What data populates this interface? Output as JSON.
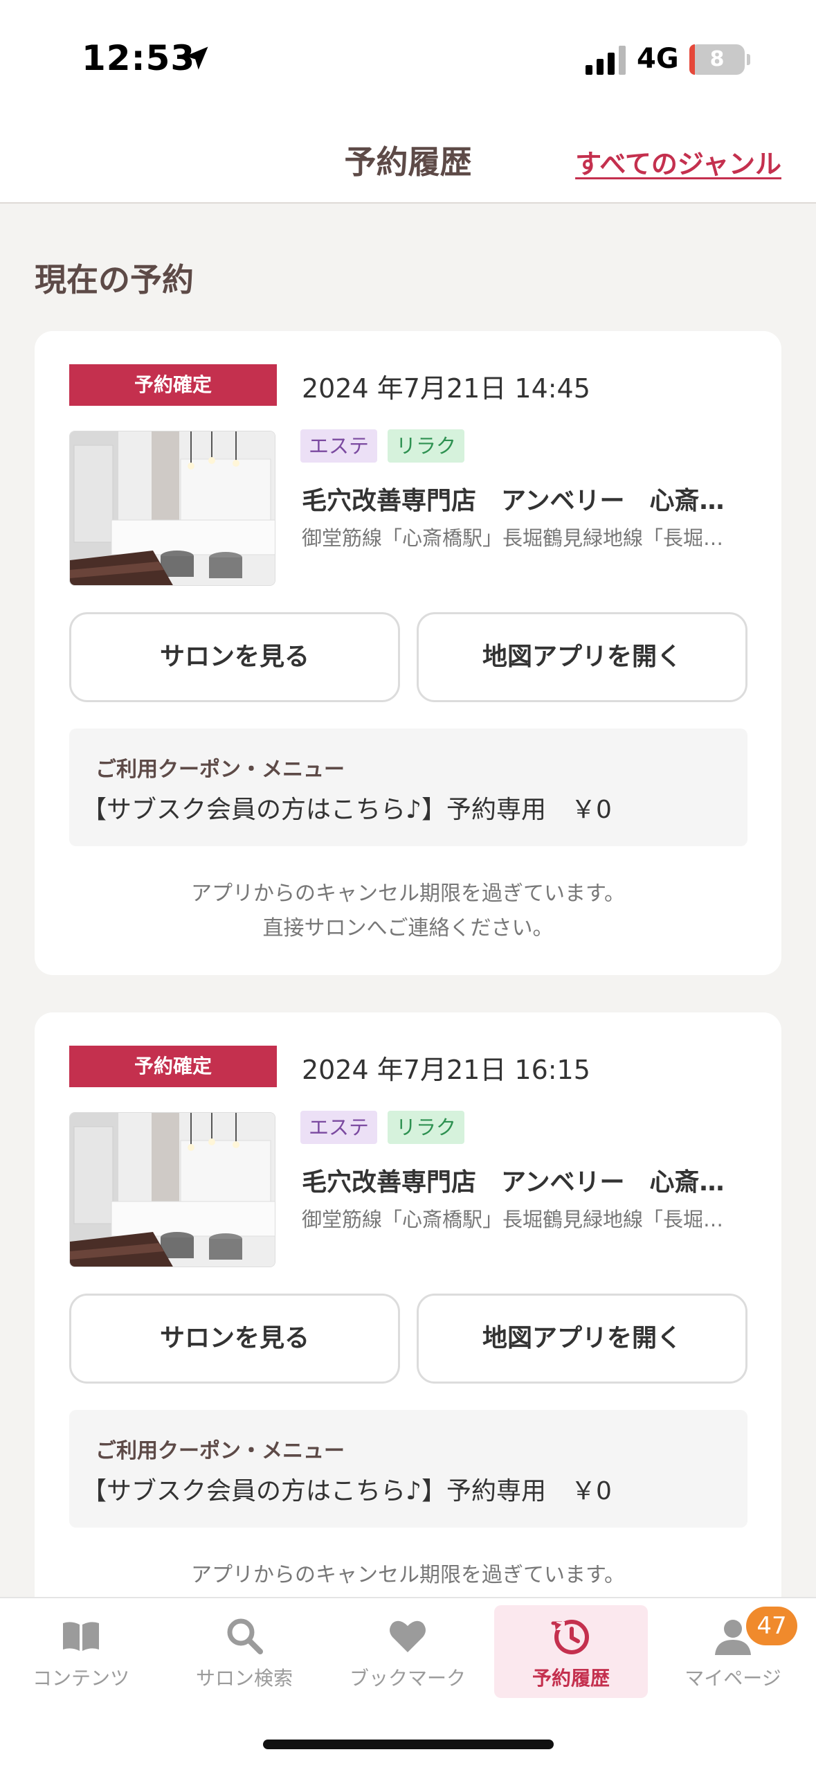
{
  "status_bar": {
    "time": "12:53",
    "network": "4G",
    "battery": "8"
  },
  "header": {
    "title": "予約履歴",
    "genre_link": "すべてのジャンル"
  },
  "section_title": "現在の予約",
  "reservations": [
    {
      "status": "予約確定",
      "datetime": "2024 年7月21日 14:45",
      "tags": [
        "エステ",
        "リラク"
      ],
      "salon_name": "毛穴改善専門店　アンベリー　心斎…",
      "access": "御堂筋線「心斎橋駅」長堀鶴見緑地線「長堀…",
      "view_salon_button": "サロンを見る",
      "open_map_button": "地図アプリを開く",
      "coupon_label": "ご利用クーポン・メニュー",
      "coupon_value": "【サブスク会員の方はこちら♪】予約専用　￥0",
      "cancel_note_line1": "アプリからのキャンセル期限を過ぎています。",
      "cancel_note_line2": "直接サロンへご連絡ください。"
    },
    {
      "status": "予約確定",
      "datetime": "2024 年7月21日 16:15",
      "tags": [
        "エステ",
        "リラク"
      ],
      "salon_name": "毛穴改善専門店　アンベリー　心斎…",
      "access": "御堂筋線「心斎橋駅」長堀鶴見緑地線「長堀…",
      "view_salon_button": "サロンを見る",
      "open_map_button": "地図アプリを開く",
      "coupon_label": "ご利用クーポン・メニュー",
      "coupon_value": "【サブスク会員の方はこちら♪】予約専用　￥0",
      "cancel_note_line1": "アプリからのキャンセル期限を過ぎています。"
    }
  ],
  "tab_bar": {
    "items": [
      {
        "label": "コンテンツ",
        "icon": "book-icon"
      },
      {
        "label": "サロン検索",
        "icon": "search-icon"
      },
      {
        "label": "ブックマーク",
        "icon": "heart-icon"
      },
      {
        "label": "予約履歴",
        "icon": "history-clock-icon",
        "active": true
      },
      {
        "label": "マイページ",
        "icon": "user-icon",
        "badge": "47"
      }
    ]
  },
  "colors": {
    "accent": "#c4304e",
    "title_brown": "#5d4a47",
    "background": "#f4f3f1",
    "badge_orange": "#f08a2c"
  }
}
